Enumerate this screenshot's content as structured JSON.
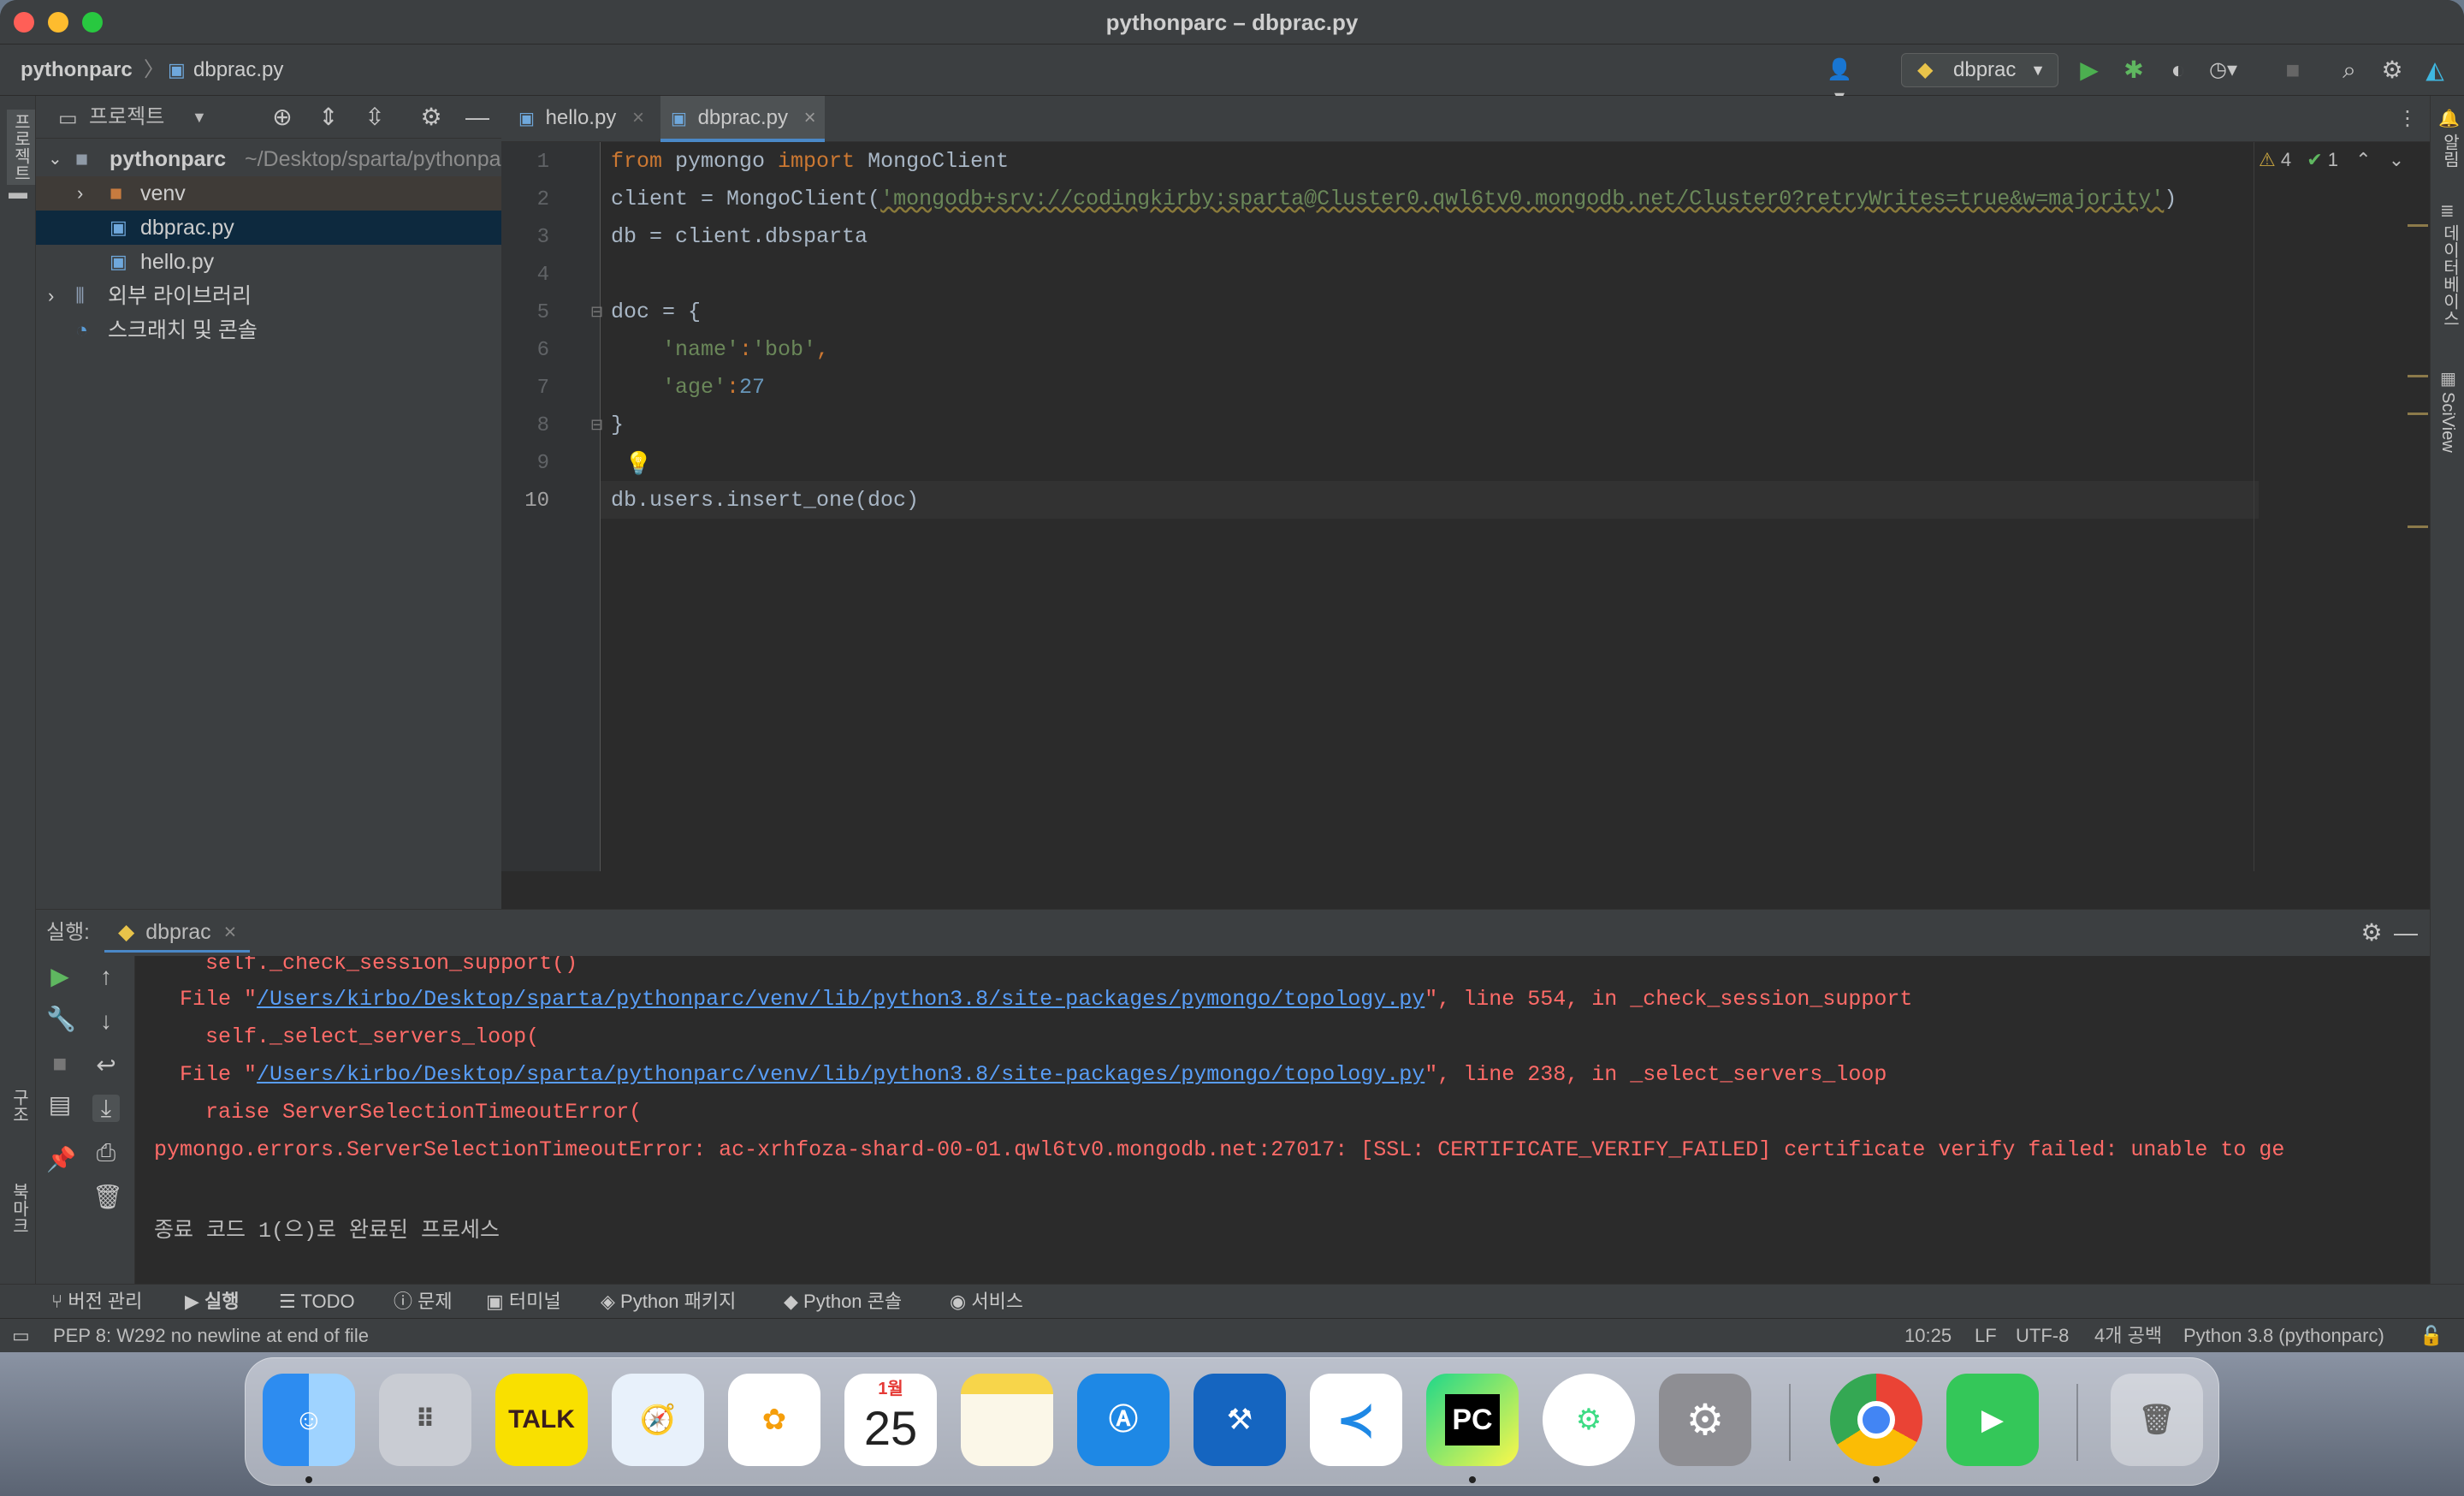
{
  "window": {
    "title": "pythonparc – dbprac.py"
  },
  "breadcrumb": {
    "project": "pythonparc",
    "file": "dbprac.py"
  },
  "toolbar": {
    "run_config": "dbprac"
  },
  "project_panel": {
    "header": "프로젝트",
    "side_tab": "프로젝트",
    "root_name": "pythonparc",
    "root_path": "~/Desktop/sparta/pythonparc",
    "items": [
      "venv",
      "dbprac.py",
      "hello.py",
      "외부 라이브러리",
      "스크래치 및 콘솔"
    ]
  },
  "tabs": [
    {
      "label": "hello.py"
    },
    {
      "label": "dbprac.py"
    }
  ],
  "editor": {
    "warnings": "4",
    "ok": "1",
    "lines": [
      {
        "n": "1",
        "a": "from",
        "b": " pymongo ",
        "c": "import",
        "d": " MongoClient"
      },
      {
        "n": "2",
        "a": "client = MongoClient(",
        "b": "'mongodb+srv://codingkirby:sparta@Cluster0.qwl6tv0.mongodb.net/Cluster0?retryWrites=true&w=majority'",
        "c": ")"
      },
      {
        "n": "3",
        "a": "db = client.dbsparta"
      },
      {
        "n": "4",
        "a": ""
      },
      {
        "n": "5",
        "a": "doc = {"
      },
      {
        "n": "6",
        "a": "    ",
        "b": "'name'",
        "c": ":",
        "d": "'bob'",
        "e": ","
      },
      {
        "n": "7",
        "a": "    ",
        "b": "'age'",
        "c": ":",
        "d": "27"
      },
      {
        "n": "8",
        "a": "}"
      },
      {
        "n": "9",
        "a": ""
      },
      {
        "n": "10",
        "a": "db.users.insert_one(doc)"
      }
    ]
  },
  "right_strip": [
    "알림",
    "데이터베이스",
    "SciView"
  ],
  "left_strip_bottom": [
    "구조",
    "북마크"
  ],
  "run_panel": {
    "label": "실행:",
    "tab": "dbprac",
    "output": [
      {
        "t": "    self._check_session_support()"
      },
      {
        "pre": "  File \"",
        "link": "/Users/kirbo/Desktop/sparta/pythonparc/venv/lib/python3.8/site-packages/pymongo/topology.py",
        "post": "\", line 554, in _check_session_support"
      },
      {
        "t": "    self._select_servers_loop("
      },
      {
        "pre": "  File \"",
        "link": "/Users/kirbo/Desktop/sparta/pythonparc/venv/lib/python3.8/site-packages/pymongo/topology.py",
        "post": "\", line 238, in _select_servers_loop"
      },
      {
        "t": "    raise ServerSelectionTimeoutError("
      },
      {
        "t": "pymongo.errors.ServerSelectionTimeoutError: ac-xrhfoza-shard-00-01.qwl6tv0.mongodb.net:27017: [SSL: CERTIFICATE_VERIFY_FAILED] certificate verify failed: unable to ge"
      },
      {
        "t": ""
      },
      {
        "t": "종료 코드 1(으)로 완료된 프로세스"
      }
    ]
  },
  "bottom_tabs": [
    "버전 관리",
    "실행",
    "TODO",
    "문제",
    "터미널",
    "Python 패키지",
    "Python 콘솔",
    "서비스"
  ],
  "status": {
    "message": "PEP 8: W292 no newline at end of file",
    "position": "10:25",
    "line_sep": "LF",
    "encoding": "UTF-8",
    "indent": "4개 공백",
    "interpreter": "Python 3.8 (pythonparc)"
  },
  "dock": {
    "calendar_month": "1월",
    "calendar_day": "25",
    "kakao_label": "TALK",
    "pycharm_label": "PC",
    "apps": [
      "finder",
      "launchpad",
      "kakaotalk",
      "safari",
      "photos",
      "calendar",
      "notes",
      "app-store",
      "xcode",
      "vscode",
      "pycharm",
      "android-studio",
      "system-settings",
      "chrome",
      "facetime",
      "trash"
    ]
  },
  "colors": {
    "editor_bg": "#2b2b2b",
    "panel_bg": "#3c3f41",
    "keyword": "#cc7832",
    "string": "#6a8759",
    "number": "#6897bb",
    "error": "#ff6b68",
    "link": "#589df6"
  }
}
